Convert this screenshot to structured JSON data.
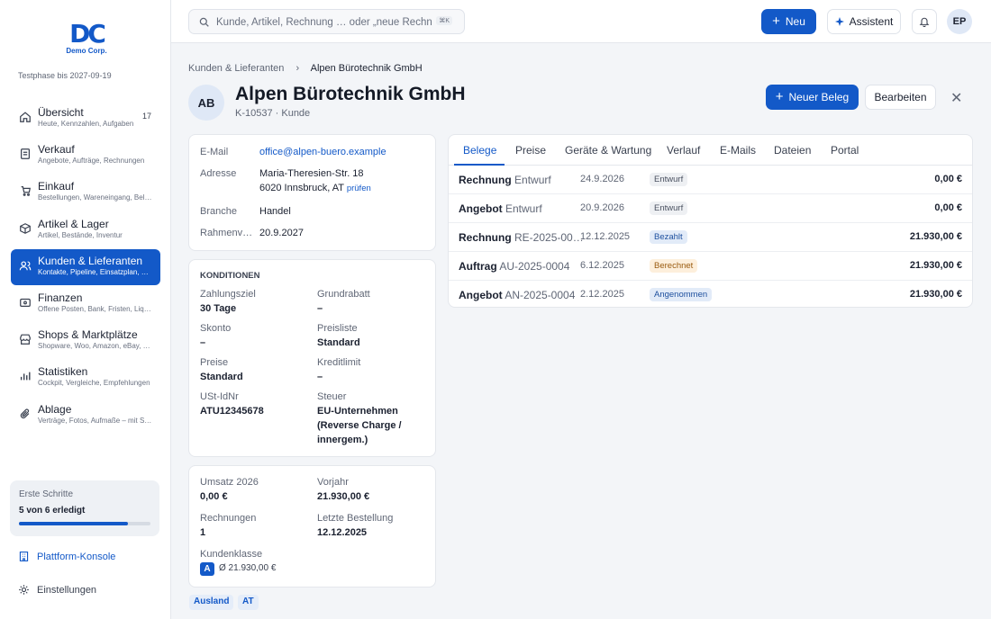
{
  "brand": {
    "logo_text": "DC",
    "company": "Demo Corp.",
    "trial": "Testphase bis 2027-09-19"
  },
  "sidebar": {
    "items": [
      {
        "label": "Übersicht",
        "sub": "Heute, Kennzahlen, Aufgaben",
        "badge": "17",
        "icon": "home-icon"
      },
      {
        "label": "Verkauf",
        "sub": "Angebote, Aufträge, Rechnungen",
        "icon": "receipt-icon"
      },
      {
        "label": "Einkauf",
        "sub": "Bestellungen, Wareneingang, Belege",
        "icon": "cart-icon"
      },
      {
        "label": "Artikel & Lager",
        "sub": "Artikel, Bestände, Inventur",
        "icon": "box-icon"
      },
      {
        "label": "Kunden & Lieferanten",
        "sub": "Kontakte, Pipeline, Einsatzplan, Service",
        "icon": "users-icon",
        "active": true
      },
      {
        "label": "Finanzen",
        "sub": "Offene Posten, Bank, Fristen, Liquidität",
        "icon": "wallet-icon"
      },
      {
        "label": "Shops & Marktplätze",
        "sub": "Shopware, Woo, Amazon, eBay, Kaufland",
        "icon": "shop-icon"
      },
      {
        "label": "Statistiken",
        "sub": "Cockpit, Vergleiche, Empfehlungen",
        "icon": "chart-icon"
      },
      {
        "label": "Ablage",
        "sub": "Verträge, Fotos, Aufmaße – mit Suche",
        "icon": "paperclip-icon"
      }
    ],
    "steps": {
      "title": "Erste Schritte",
      "progress_text": "5 von 6 erledigt",
      "progress": 0.83
    },
    "platform": "Plattform-Konsole",
    "settings": "Einstellungen"
  },
  "topbar": {
    "search_placeholder": "Kunde, Artikel, Rechnung … oder „neue Rechnung“",
    "shortcut": "⌘K",
    "new_label": "Neu",
    "assistant_label": "Assistent",
    "user_initials": "EP"
  },
  "breadcrumb": {
    "parent": "Kunden & Lieferanten",
    "current": "Alpen Bürotechnik GmbH"
  },
  "header": {
    "initials": "AB",
    "title": "Alpen Bürotechnik GmbH",
    "subtitle": "K-10537 · Kunde",
    "new_doc": "Neuer Beleg",
    "edit": "Bearbeiten"
  },
  "contact": {
    "email_label": "E-Mail",
    "email": "office@alpen-buero.example",
    "address_label": "Adresse",
    "address1": "Maria-Theresien-Str. 18",
    "address2": "6020 Innsbruck, AT",
    "verify": "prüfen",
    "branch_label": "Branche",
    "branch": "Handel",
    "contract_label": "Rahmenv…",
    "contract": "20.9.2027"
  },
  "conditions": {
    "title": "KONDITIONEN",
    "payment_label": "Zahlungsziel",
    "payment": "30 Tage",
    "discount_label": "Grundrabatt",
    "discount": "–",
    "skonto_label": "Skonto",
    "skonto": "–",
    "pricelist_label": "Preisliste",
    "pricelist": "Standard",
    "prices_label": "Preise",
    "prices": "Standard",
    "credit_label": "Kreditlimit",
    "credit": "–",
    "vat_label": "USt-IdNr",
    "vat": "ATU12345678",
    "tax_label": "Steuer",
    "tax1": "EU-Unternehmen",
    "tax2": "(Reverse Charge /",
    "tax3": "innergem.)"
  },
  "stats": {
    "rev_label": "Umsatz 2026",
    "rev": "0,00 €",
    "prev_label": "Vorjahr",
    "prev": "21.930,00 €",
    "inv_label": "Rechnungen",
    "inv": "1",
    "last_label": "Letzte Bestellung",
    "last": "12.12.2025",
    "class_label": "Kundenklasse",
    "class": "A",
    "avg": "Ø 21.930,00 €"
  },
  "tags": [
    "Ausland",
    "AT"
  ],
  "tabs": [
    "Belege",
    "Preise",
    "Geräte & Wartung",
    "Verlauf",
    "E-Mails",
    "Dateien",
    "Portal"
  ],
  "docs": [
    {
      "type": "Rechnung",
      "no": "Entwurf",
      "date": "24.9.2026",
      "status": "Entwurf",
      "status_color": "#eef0f3",
      "status_text": "#4a5160",
      "amount": "0,00 €"
    },
    {
      "type": "Angebot",
      "no": "Entwurf",
      "date": "20.9.2026",
      "status": "Entwurf",
      "status_color": "#eef0f3",
      "status_text": "#4a5160",
      "amount": "0,00 €"
    },
    {
      "type": "Rechnung",
      "no": "RE-2025-00…",
      "date": "12.12.2025",
      "status": "Bezahlt",
      "status_color": "#e2ebf8",
      "status_text": "#1d4f9e",
      "amount": "21.930,00 €"
    },
    {
      "type": "Auftrag",
      "no": "AU-2025-0004",
      "date": "6.12.2025",
      "status": "Berechnet",
      "status_color": "#fdefdc",
      "status_text": "#9a5b10",
      "amount": "21.930,00 €"
    },
    {
      "type": "Angebot",
      "no": "AN-2025-0004",
      "date": "2.12.2025",
      "status": "Angenommen",
      "status_color": "#e2ebf8",
      "status_text": "#1d4f9e",
      "amount": "21.930,00 €"
    }
  ],
  "colors": {
    "accent": "#1359c8"
  }
}
